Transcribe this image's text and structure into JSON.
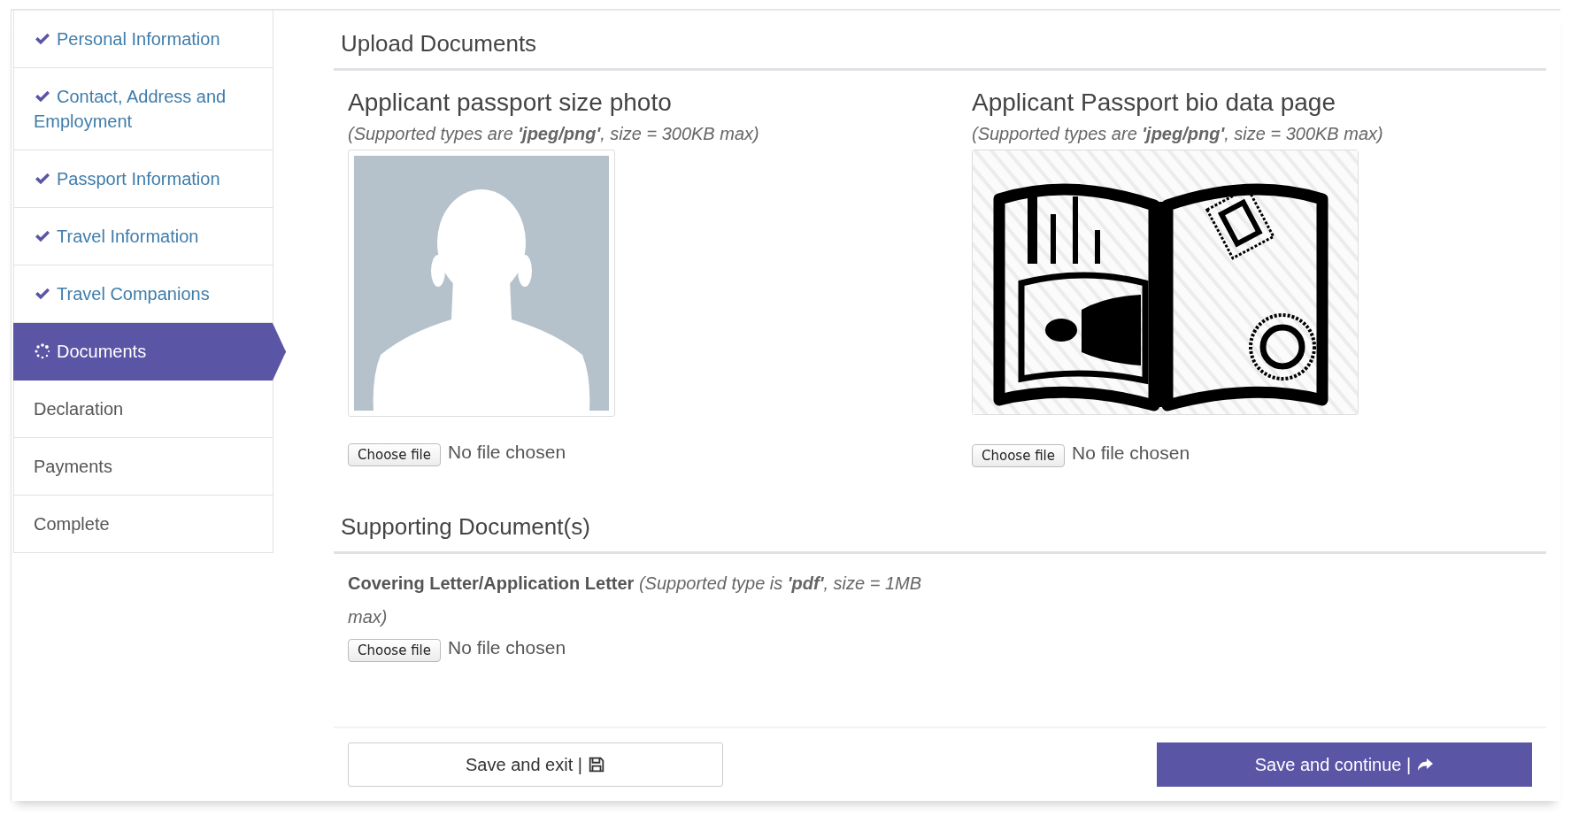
{
  "sidebar": {
    "items": [
      {
        "label": "Personal Information",
        "completed": true,
        "selected": false
      },
      {
        "label": "Contact, Address and Employment",
        "completed": true,
        "selected": false
      },
      {
        "label": "Passport Information",
        "completed": true,
        "selected": false
      },
      {
        "label": "Travel Information",
        "completed": true,
        "selected": false
      },
      {
        "label": "Travel Companions",
        "completed": true,
        "selected": false
      },
      {
        "label": "Documents",
        "completed": false,
        "selected": true
      },
      {
        "label": "Declaration",
        "completed": false,
        "selected": false
      },
      {
        "label": "Payments",
        "completed": false,
        "selected": false
      },
      {
        "label": "Complete",
        "completed": false,
        "selected": false
      }
    ]
  },
  "upload_section": {
    "title": "Upload Documents",
    "uploads": [
      {
        "title": "Applicant passport size photo",
        "hint": "(Supported types are **'jpeg/png'**, size = 300KB max)",
        "kind": "portrait",
        "button": "Choose file",
        "status": "No file chosen"
      },
      {
        "title": "Applicant Passport bio data page",
        "hint": "(Supported types are **'jpeg/png'**, size = 300KB max)",
        "kind": "passport",
        "button": "Choose file",
        "status": "No file chosen"
      }
    ]
  },
  "supporting_section": {
    "title": "Supporting Document(s)",
    "documents": [
      {
        "label": "Covering Letter/Application Letter",
        "hint": "(Supported type is **'pdf'**, size = 1MB max)",
        "button": "Choose file",
        "status": "No file chosen"
      }
    ]
  },
  "actions": [
    {
      "label": "Save and exit |",
      "kind": "secondary"
    },
    {
      "label": "Save and continue |",
      "kind": "primary"
    }
  ]
}
